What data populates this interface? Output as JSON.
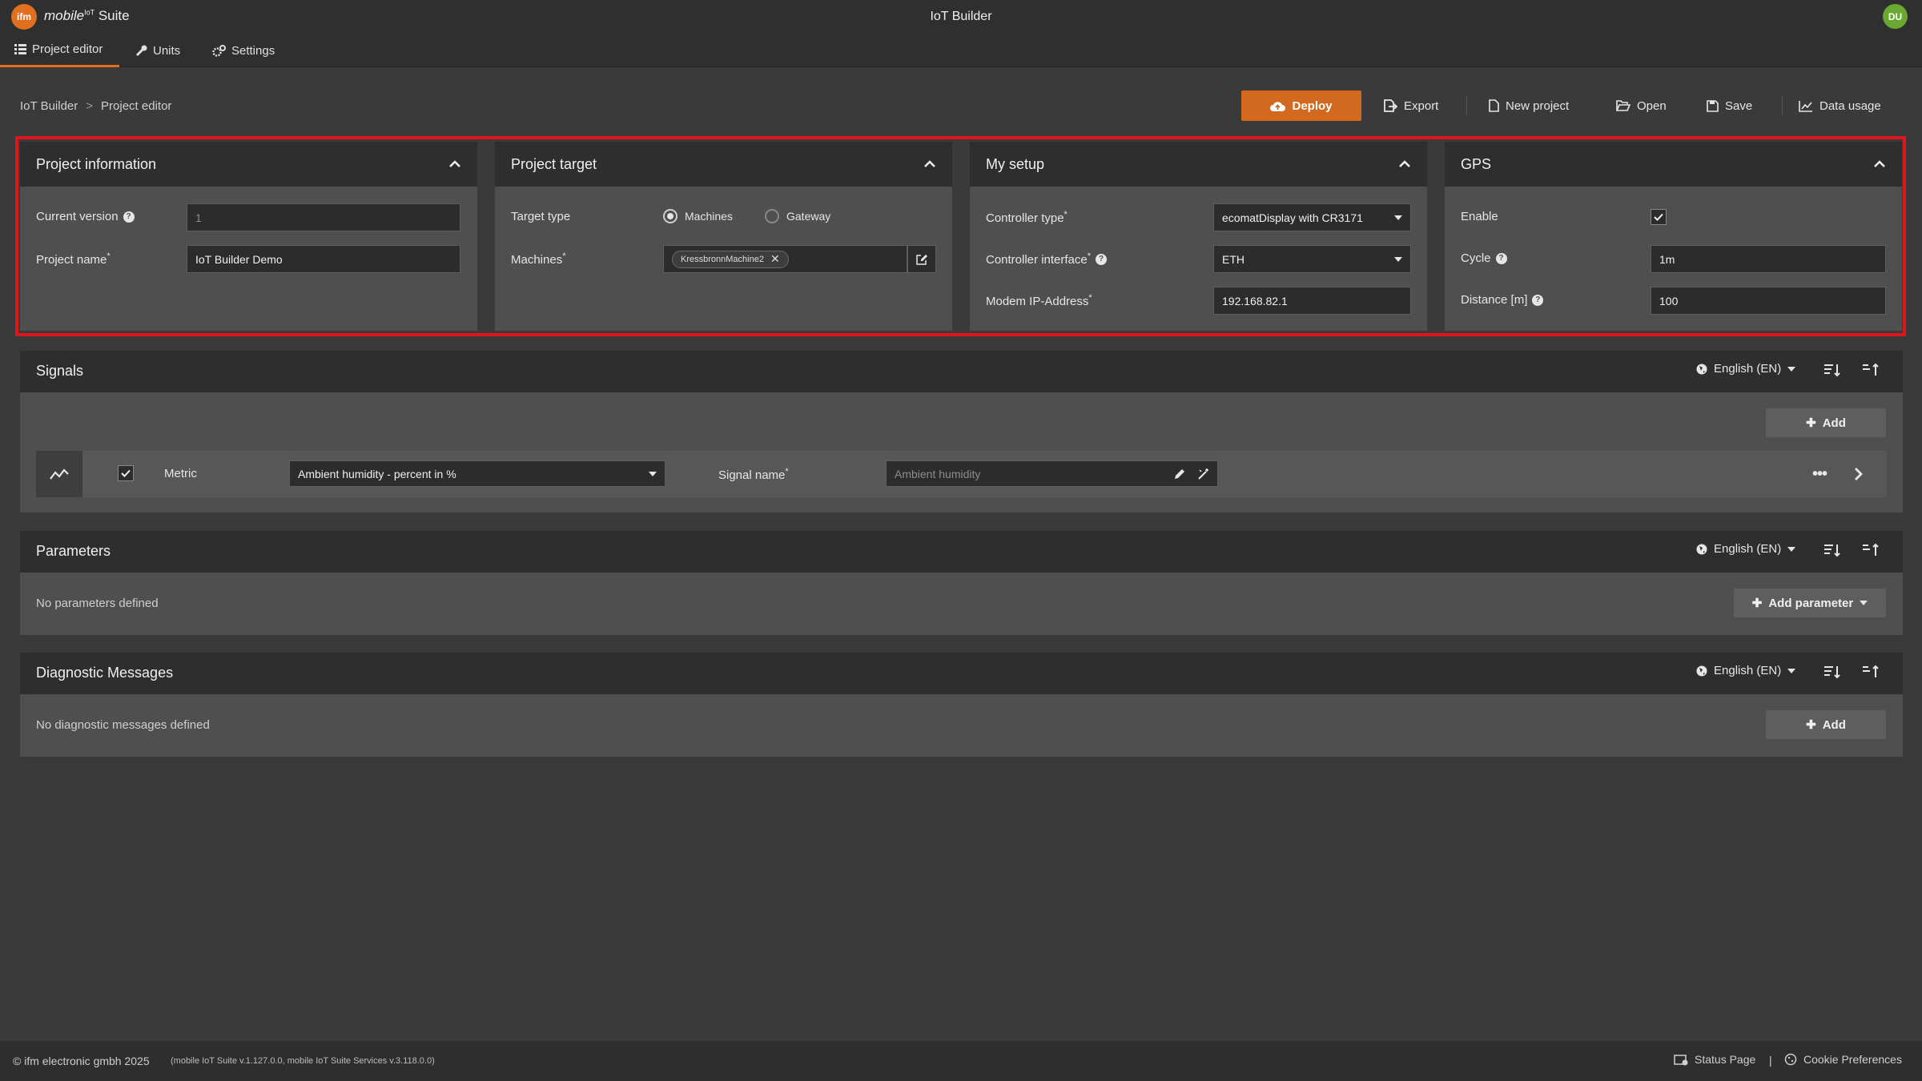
{
  "header": {
    "logo_text": "ifm",
    "brand_mobile": "mobile",
    "brand_iot": "IoT",
    "brand_suite": " Suite",
    "app_title": "IoT Builder",
    "avatar": "DU"
  },
  "tabs": [
    {
      "label": "Project editor",
      "icon": "list-icon"
    },
    {
      "label": "Units",
      "icon": "wrench-icon"
    },
    {
      "label": "Settings",
      "icon": "gears-icon"
    }
  ],
  "breadcrumb": {
    "root": "IoT Builder",
    "sep": ">",
    "current": "Project editor"
  },
  "toolbar": {
    "deploy": "Deploy",
    "export": "Export",
    "new_project": "New project",
    "open": "Open",
    "save": "Save",
    "data_usage": "Data usage"
  },
  "project_info": {
    "title": "Project information",
    "version_label": "Current version",
    "version_value": "1",
    "name_label": "Project name",
    "name_value": "IoT Builder Demo",
    "required": "*"
  },
  "project_target": {
    "title": "Project target",
    "type_label": "Target type",
    "opt_machines": "Machines",
    "opt_gateway": "Gateway",
    "selected": "Machines",
    "machines_label": "Machines",
    "machine_chip": "KressbronnMachine2"
  },
  "my_setup": {
    "title": "My setup",
    "controller_type_label": "Controller type",
    "controller_type_value": "ecomatDisplay with CR3171",
    "controller_interface_label": "Controller interface",
    "controller_interface_value": "ETH",
    "modem_label": "Modem IP-Address",
    "modem_value": "192.168.82.1"
  },
  "gps": {
    "title": "GPS",
    "enable_label": "Enable",
    "enable_checked": true,
    "cycle_label": "Cycle",
    "cycle_value": "1m",
    "distance_label": "Distance [m]",
    "distance_value": "100"
  },
  "signals": {
    "title": "Signals",
    "language": "English (EN)",
    "add": "Add",
    "row": {
      "type": "Metric",
      "select_value": "Ambient humidity - percent in %",
      "name_label": "Signal name",
      "name_placeholder": "Ambient humidity"
    }
  },
  "parameters": {
    "title": "Parameters",
    "language": "English (EN)",
    "empty": "No parameters defined",
    "add": "Add parameter"
  },
  "diagnostics": {
    "title": "Diagnostic Messages",
    "language": "English (EN)",
    "empty": "No diagnostic messages defined",
    "add": "Add"
  },
  "footer": {
    "copyright": "© ifm electronic gmbh 2025",
    "version": "(mobile IoT Suite v.1.127.0.0, mobile IoT Suite Services v.3.118.0.0)",
    "status": "Status Page",
    "sep": "|",
    "cookies": "Cookie Preferences"
  },
  "colors": {
    "accent": "#e07020",
    "deploy": "#d2691e",
    "highlight": "#e0151b",
    "avatar": "#6aa832"
  }
}
